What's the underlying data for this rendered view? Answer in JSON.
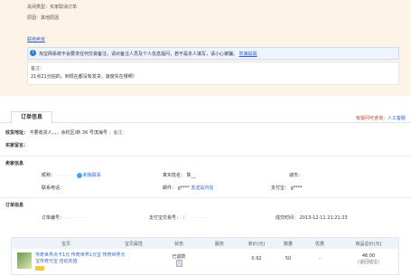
{
  "close_info": {
    "type_line": "关闭类型：买家取消订单",
    "reason_line": "原因：其他原因"
  },
  "link_text": "联络卖家",
  "warning": {
    "text": "淘宝网系统不会要求任何交易备注，请对备注人员及个人信息提问，若不是本人填写，请小心被骗。",
    "link": "防骗提醒"
  },
  "remark": {
    "label": "备注：",
    "text": "21点21分拍的，到现在都没有发货，速度实在慢啊！"
  },
  "tab_label": "订单信息",
  "help": {
    "prefix": "有疑问可咨询：",
    "link": "人工客服"
  },
  "address": {
    "label": "收货地址：",
    "value": "不要收货人，，，余杭区/新 36 号滨海号",
    "note": "，备注："
  },
  "buyer_note_label": "买家留言：",
  "seller_section": {
    "title": "卖家信息",
    "nick_label": "昵称：",
    "nick_value": "········",
    "contact": "和我联系",
    "realname_label": "真实姓名：",
    "realname_value": "陈__",
    "city_label": "城市：",
    "phone_label": "联系电话：",
    "email_label": "邮件：",
    "email_value": "g****",
    "email_link": "发送站内信",
    "alipay_label": "支付宝：",
    "alipay_value": "g****"
  },
  "order_section": {
    "title": "订单信息",
    "orderno_label": "订单编号：",
    "orderno_value": "·········",
    "alipayno_label": "支付宝交易号：",
    "alipayno_value": "2·········",
    "success_label": "成交时间：",
    "success_value": "2013-12-11 21:21:23"
  },
  "table": {
    "headers": [
      "宝贝",
      "宝贝属性",
      "状态",
      "服务",
      "单价(元)",
      "数量",
      "优惠",
      "商品总价(元)"
    ],
    "row": {
      "name": "传奇世界点卡1元 传奇世界1元宝 传奇世界元宝传奇元宝 自动充值",
      "attr": "",
      "status": "已退款",
      "service": "",
      "price": "0.92",
      "qty": "50",
      "discount": "-",
      "total": "46.00",
      "total_note": "(退回钱宝)"
    }
  }
}
